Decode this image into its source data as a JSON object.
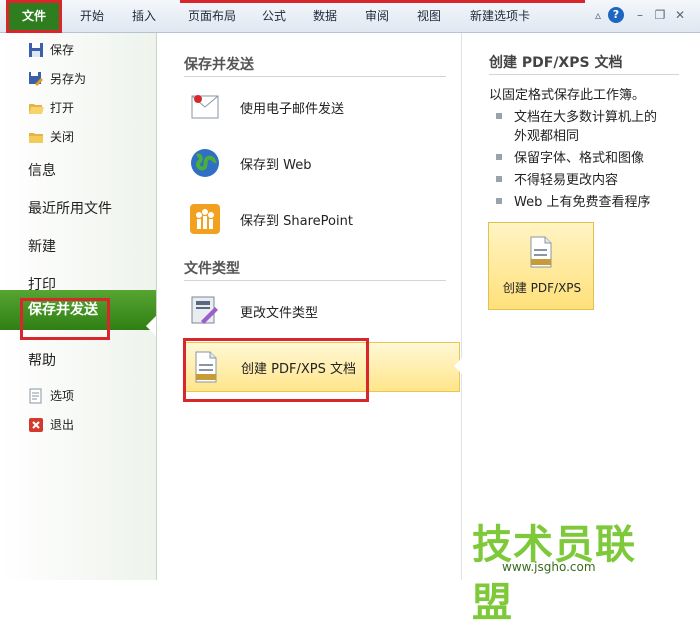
{
  "ribbon": {
    "tabs": [
      "文件",
      "开始",
      "插入",
      "页面布局",
      "公式",
      "数据",
      "审阅",
      "视图",
      "新建选项卡"
    ]
  },
  "window_controls": {
    "help": "?"
  },
  "left_nav": {
    "commands_top": [
      "保存",
      "另存为",
      "打开",
      "关闭"
    ],
    "info": "信息",
    "recent": "最近所用文件",
    "new": "新建",
    "print": "打印",
    "save_send": "保存并发送",
    "help": "帮助",
    "commands_bottom": [
      "选项",
      "退出"
    ]
  },
  "middle": {
    "section1_title": "保存并发送",
    "options1": [
      "使用电子邮件发送",
      "保存到 Web",
      "保存到 SharePoint"
    ],
    "section2_title": "文件类型",
    "options2": [
      "更改文件类型",
      "创建 PDF/XPS 文档"
    ]
  },
  "right": {
    "title": "创建 PDF/XPS 文档",
    "description": "以固定格式保存此工作簿。",
    "bullets": [
      "文档在大多数计算机上的",
      "外观都相同",
      "保留字体、格式和图像",
      "不得轻易更改内容",
      "Web 上有免费查看程序"
    ],
    "button_label": "创建 PDF/XPS"
  },
  "watermark": {
    "text": "技术员联盟",
    "url": "www.jsgho.com"
  },
  "colors": {
    "accent_green": "#2e7d1f",
    "highlight_red": "#d8262d",
    "selected_yellow": "#ffe58a"
  }
}
